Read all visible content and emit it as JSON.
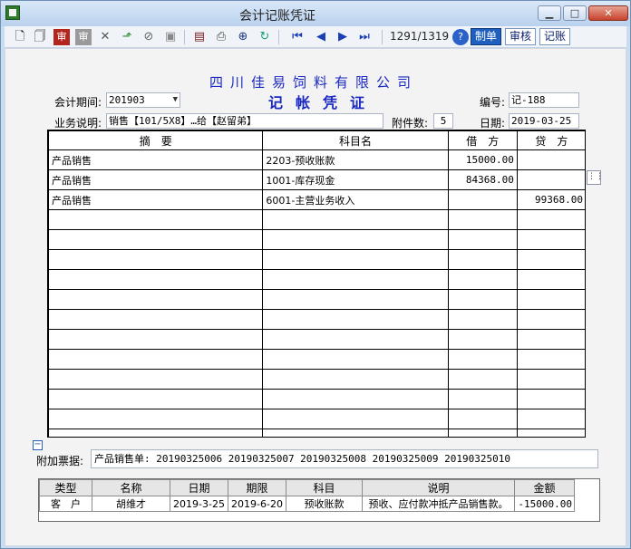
{
  "window": {
    "title": "会计记账凭证"
  },
  "toolbar": {
    "counter": "1291/1319",
    "modes": [
      {
        "label": "制单",
        "active": true
      },
      {
        "label": "审核",
        "active": false
      },
      {
        "label": "记账",
        "active": false
      }
    ],
    "icons": [
      "new-icon",
      "copy-icon",
      "audit-icon",
      "unaudit-icon",
      "delete-icon",
      "export-icon",
      "cancel-icon",
      "save-icon",
      "document-icon",
      "print-icon",
      "find-icon",
      "refresh-icon",
      "first-icon",
      "prev-icon",
      "next-icon",
      "last-icon",
      "help-icon"
    ]
  },
  "header": {
    "company": "四川佳易饲料有限公司",
    "voucher_title": "记帐凭证",
    "period_label": "会计期间:",
    "period_value": "201903",
    "number_label": "编号:",
    "number_value": "记-188",
    "desc_label": "业务说明:",
    "desc_value": "销售【101/5X8】…给【赵留弟】",
    "attach_count_label": "附件数:",
    "attach_count_value": "5",
    "date_label": "日期:",
    "date_value": "2019-03-25"
  },
  "grid": {
    "columns": [
      "摘　要",
      "科目名",
      "借　方",
      "贷　方"
    ],
    "rows": [
      {
        "summary": "产品销售",
        "account": "2203-预收账款",
        "debit": "15000.00",
        "credit": ""
      },
      {
        "summary": "产品销售",
        "account": "1001-库存现金",
        "debit": "84368.00",
        "credit": ""
      },
      {
        "summary": "产品销售",
        "account": "6001-主营业务收入",
        "debit": "",
        "credit": "99368.00"
      }
    ],
    "empty_rows": 12
  },
  "attachment": {
    "label": "附加票据:",
    "value": "产品销售单: 20190325006 20190325007 20190325008 20190325009 20190325010"
  },
  "subtable": {
    "columns": [
      "类型",
      "名称",
      "日期",
      "期限",
      "科目",
      "说明",
      "金额"
    ],
    "rows": [
      {
        "type": "客　户",
        "name": "胡维才",
        "date": "2019-3-25",
        "term": "2019-6-20",
        "account": "预收账款",
        "note": "预收、应付款冲抵产品销售款。",
        "amount": "-15000.00"
      }
    ]
  }
}
